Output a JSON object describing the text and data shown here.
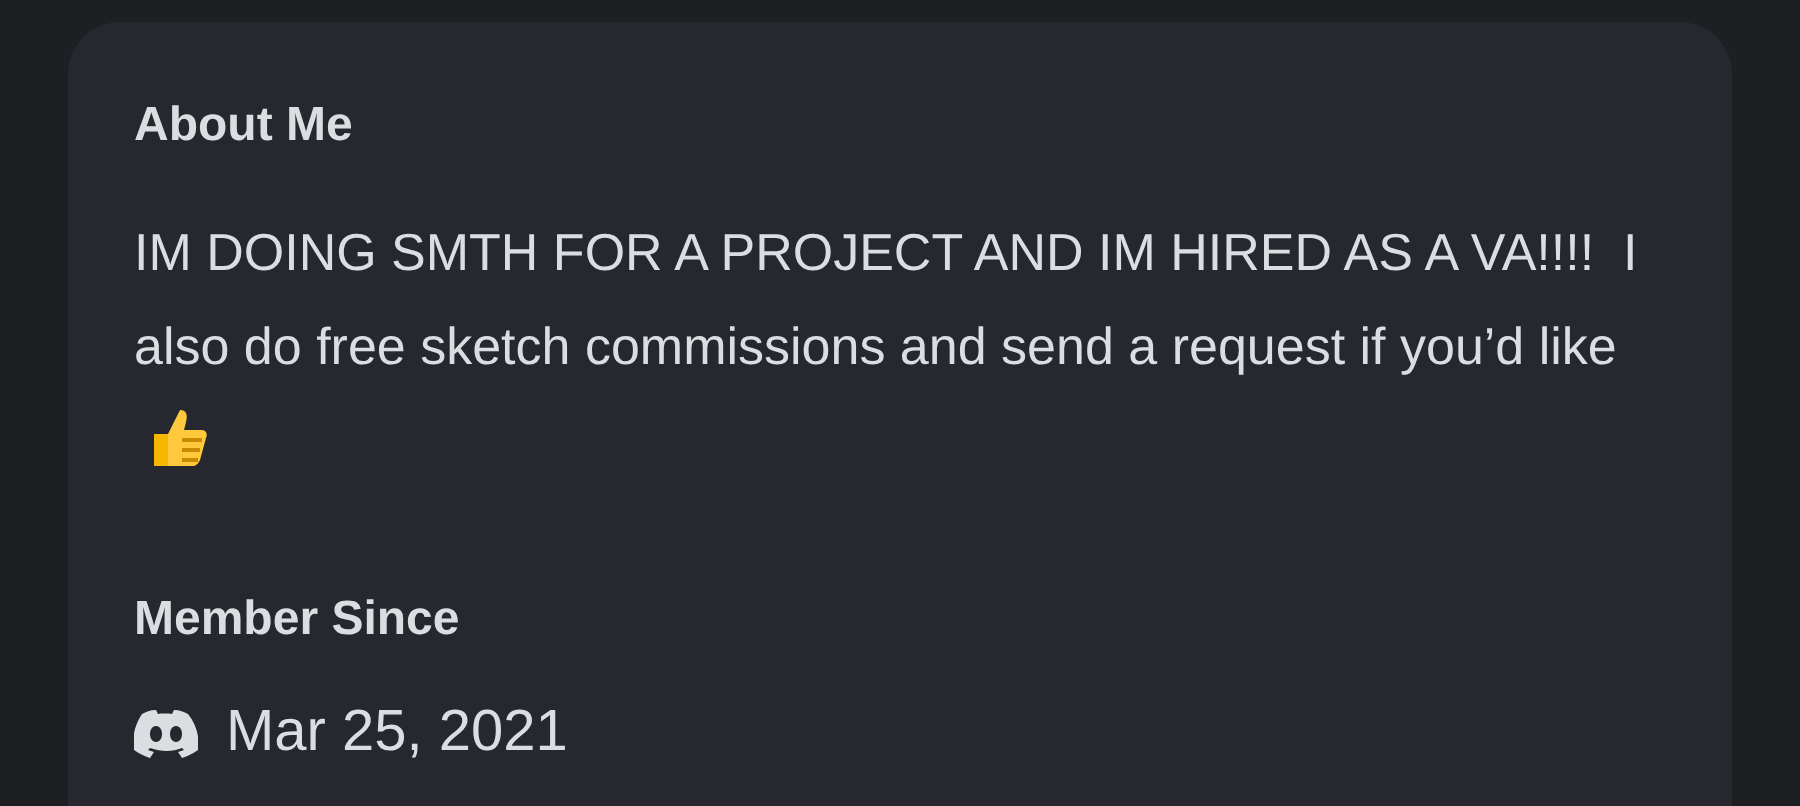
{
  "about_me": {
    "heading": "About Me",
    "text": "IM DOING SMTH FOR A PROJECT AND IM HIRED AS A VA!!!!  I also do free sketch commissions and send a request if you’d like"
  },
  "member_since": {
    "heading": "Member Since",
    "date": "Mar 25, 2021"
  }
}
